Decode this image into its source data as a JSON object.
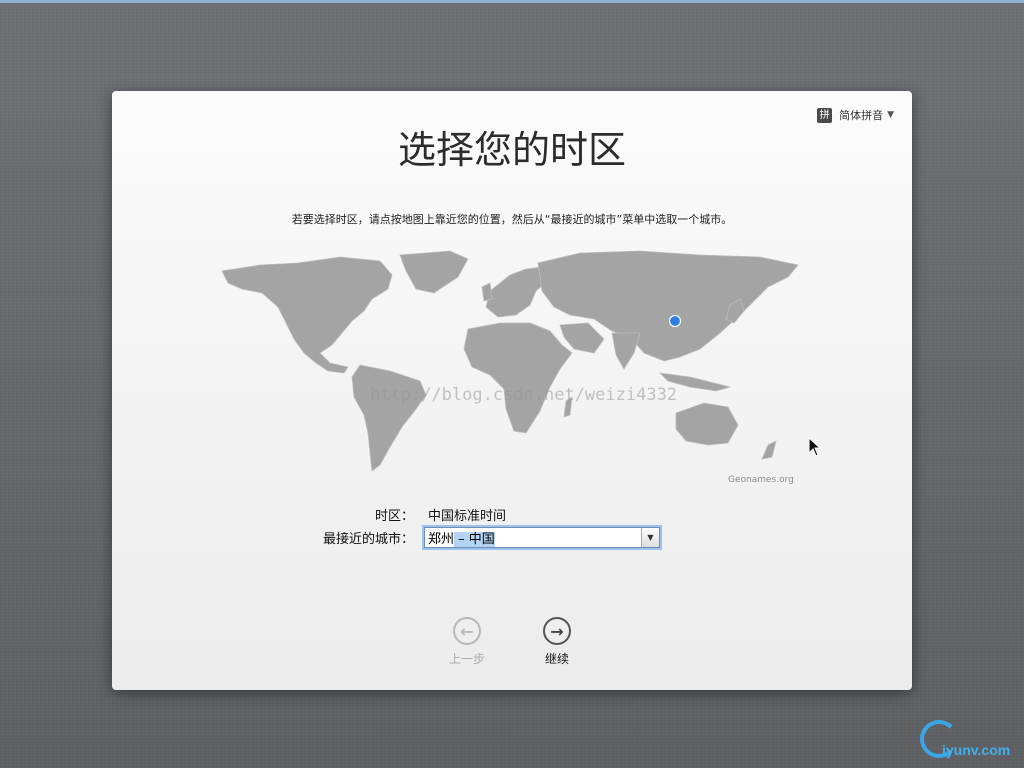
{
  "window": {
    "title": "选择您的时区",
    "instruction": "若要选择时区，请点按地图上靠近您的位置，然后从“最接近的城市”菜单中选取一个城市。"
  },
  "input_menu": {
    "badge": "拼",
    "label": "简体拼音",
    "arrow": "▼"
  },
  "map": {
    "credit": "Geonames.org",
    "watermark": "http://blog.csdn.net/weizi4332",
    "pin_color": "#2f7de0"
  },
  "timezone": {
    "label": "时区：",
    "value": "中国标准时间"
  },
  "city": {
    "label": "最接近的城市：",
    "value_city": "郑州",
    "value_rest": " – 中国"
  },
  "nav": {
    "back_label": "上一步",
    "continue_label": "继续"
  },
  "logo": {
    "text": "iyunv.com"
  }
}
